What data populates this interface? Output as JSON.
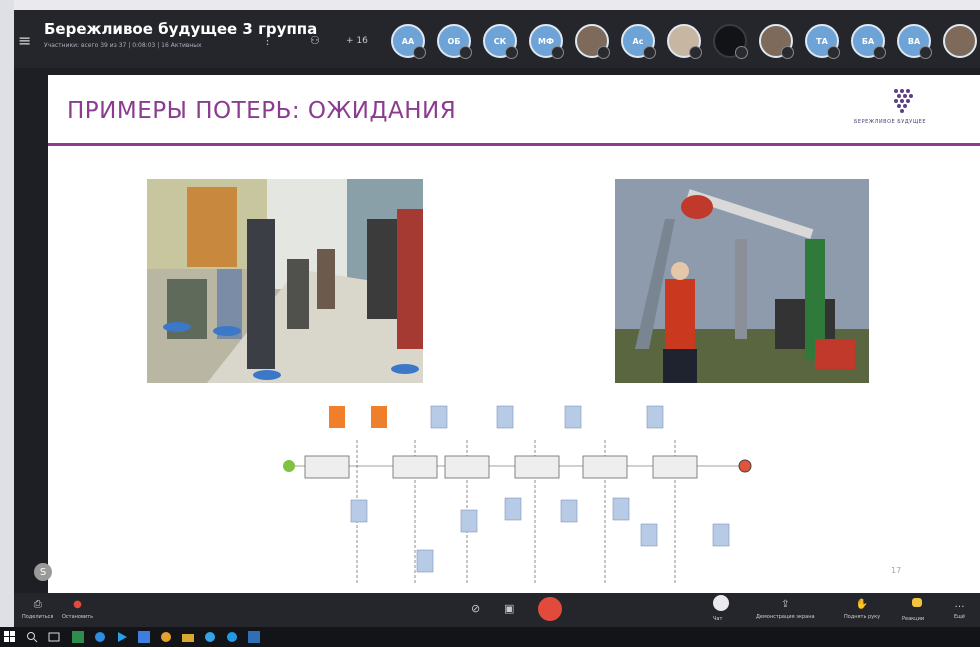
{
  "header": {
    "title": "Бережливое будущее 3 группа",
    "subtitle": "Участники: всего 39 из 37 | 0:08:03 | 16 Активных",
    "extra_count": "+ 16",
    "avatars": [
      "АА",
      "ОБ",
      "СК",
      "МФ",
      "",
      "Ас",
      "",
      "",
      "",
      "ТА",
      "БА",
      "ВА",
      ""
    ]
  },
  "slide": {
    "title": "ПРИМЕРЫ ПОТЕРЬ: ОЖИДАНИЯ",
    "logo_text": "БЕРЕЖЛИВОЕ БУДУЩЕЕ",
    "page_number": "17"
  },
  "bottom_bar": {
    "share": "Поделиться",
    "stop": "Остановить",
    "chat": "Чат",
    "screen_share": "Демонстрация экрана",
    "raise_hand": "Поднять руку",
    "reactions": "Реакции",
    "more": "Ещё"
  },
  "colors": {
    "accent_purple": "#8b3c91",
    "hangup_red": "#e24b3b",
    "avatar_blue": "#6ea3d8"
  }
}
